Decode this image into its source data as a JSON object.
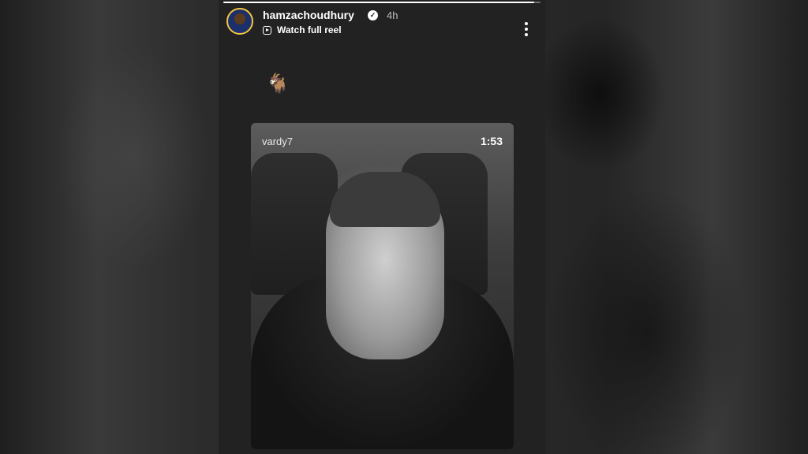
{
  "story": {
    "progress_fraction": 0.98,
    "username": "hamzachoudhury",
    "verified_mark": "✓",
    "timestamp": "4h",
    "reel_link_label": "Watch full reel",
    "reel_link_icon": "reel-icon",
    "more_icon": "more-vertical-icon",
    "caption_emoji": "🐐"
  },
  "reel": {
    "author": "vardy7",
    "duration": "1:53"
  }
}
